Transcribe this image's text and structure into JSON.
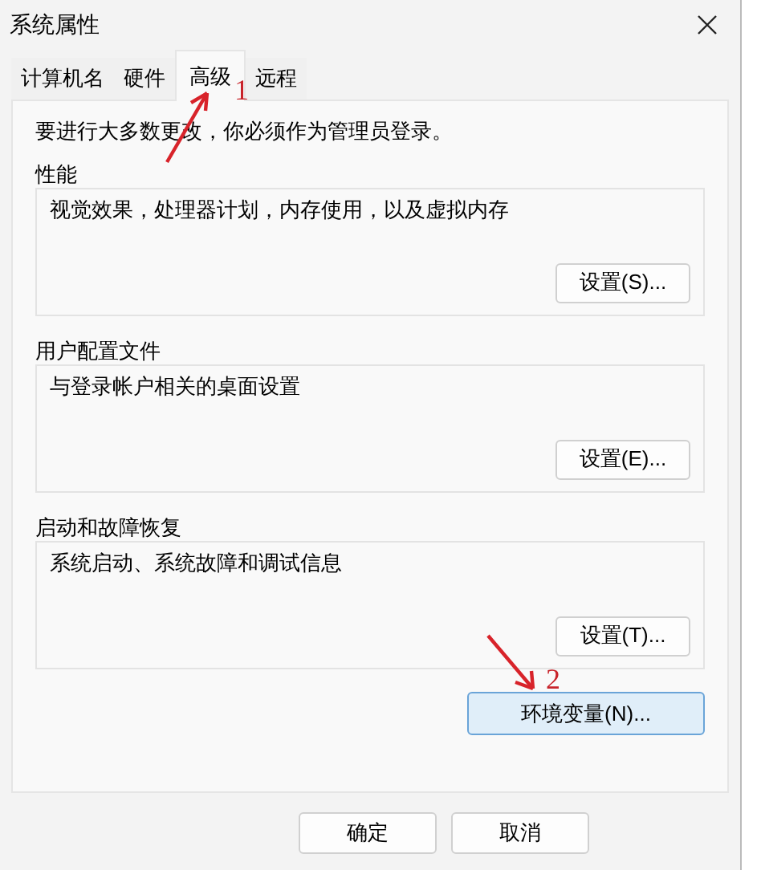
{
  "window": {
    "title": "系统属性"
  },
  "tabs": [
    {
      "label": "计算机名",
      "selected": false
    },
    {
      "label": "硬件",
      "selected": false
    },
    {
      "label": "高级",
      "selected": true
    },
    {
      "label": "远程",
      "selected": false
    }
  ],
  "notice": "要进行大多数更改，你必须作为管理员登录。",
  "groups": [
    {
      "title": "性能",
      "description": "视觉效果，处理器计划，内存使用，以及虚拟内存",
      "button": "设置(S)..."
    },
    {
      "title": "用户配置文件",
      "description": "与登录帐户相关的桌面设置",
      "button": "设置(E)..."
    },
    {
      "title": "启动和故障恢复",
      "description": "系统启动、系统故障和调试信息",
      "button": "设置(T)..."
    }
  ],
  "env_button": {
    "label": "环境变量(N)...",
    "selected": true
  },
  "buttons": [
    "确定",
    "取消"
  ],
  "annotations": [
    {
      "label": "1"
    },
    {
      "label": "2"
    }
  ]
}
